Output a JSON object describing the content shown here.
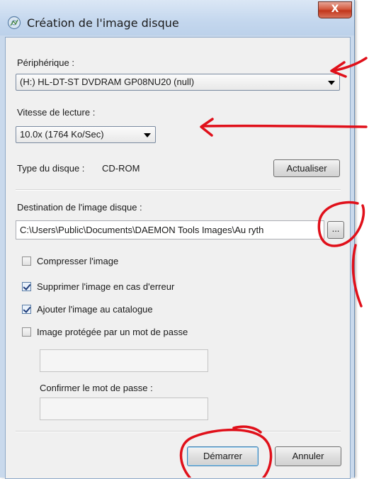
{
  "window": {
    "title": "Création de l'image disque",
    "close_label": "X"
  },
  "device": {
    "label": "Périphérique :",
    "selected": "(H:) HL-DT-ST DVDRAM GP08NU20 (null)"
  },
  "speed": {
    "label": "Vitesse de lecture :",
    "selected": "10.0x (1764 Ko/Sec)"
  },
  "disc_type": {
    "label": "Type du disque :",
    "value": "CD-ROM",
    "refresh_label": "Actualiser"
  },
  "destination": {
    "label": "Destination de l'image disque :",
    "value": "C:\\Users\\Public\\Documents\\DAEMON Tools Images\\Au ryth",
    "browse_label": "..."
  },
  "options": [
    {
      "label": "Compresser l'image",
      "checked": false
    },
    {
      "label": "Supprimer l'image en cas d'erreur",
      "checked": true
    },
    {
      "label": "Ajouter l'image au catalogue",
      "checked": true
    },
    {
      "label": "Image protégée par un mot de passe",
      "checked": false
    }
  ],
  "password": {
    "confirm_label": "Confirmer le mot de passe :"
  },
  "actions": {
    "start_label": "Démarrer",
    "cancel_label": "Annuler"
  },
  "colors": {
    "annotation": "#e0101a",
    "accent": "#3c7fb1"
  }
}
